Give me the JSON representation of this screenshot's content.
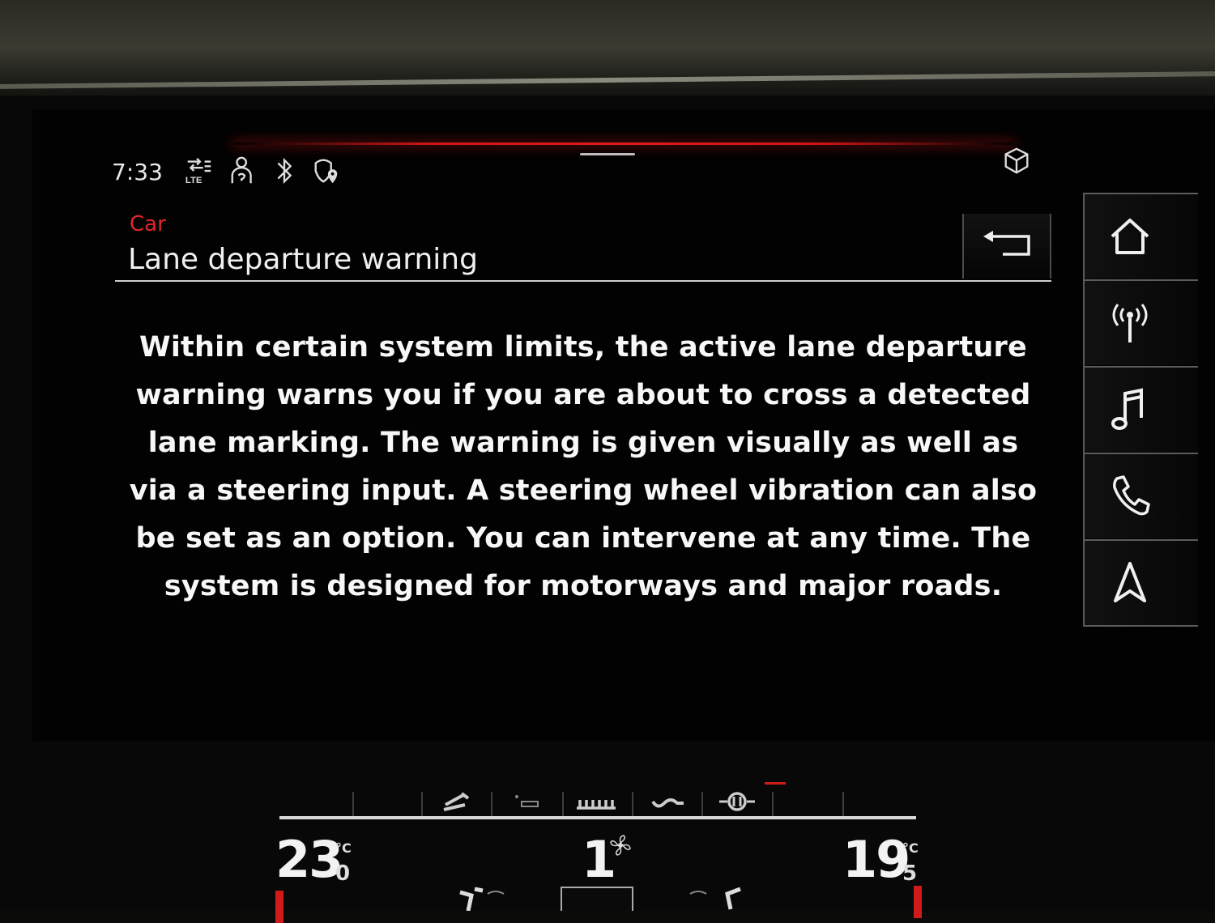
{
  "status_bar": {
    "time": "7:33",
    "network_label": "LTE",
    "icons": [
      "network-lte-icon",
      "driver-profile-icon",
      "bluetooth-icon",
      "location-shield-icon"
    ],
    "top_right_icon": "cube-3d-icon"
  },
  "header": {
    "breadcrumb": "Car",
    "title": "Lane departure warning",
    "back_icon": "back-arrow-icon"
  },
  "content": {
    "text": "Within certain system limits, the active lane departure warning warns you if you are about to cross a detected lane marking. The warning is given visually as well as via a steering input. A steering wheel vibration can also be set as an option. You can intervene at any time. The system is designed for motorways and major roads."
  },
  "nav_rail": {
    "items": [
      "home-icon",
      "radio-icon",
      "music-icon",
      "phone-icon",
      "navigation-icon"
    ]
  },
  "climate": {
    "left_temp": "23",
    "left_temp_decimal": "0",
    "right_temp": "19",
    "right_temp_decimal": "5",
    "unit": "°C",
    "fan_level": "1",
    "accent": "#d01b1b"
  }
}
